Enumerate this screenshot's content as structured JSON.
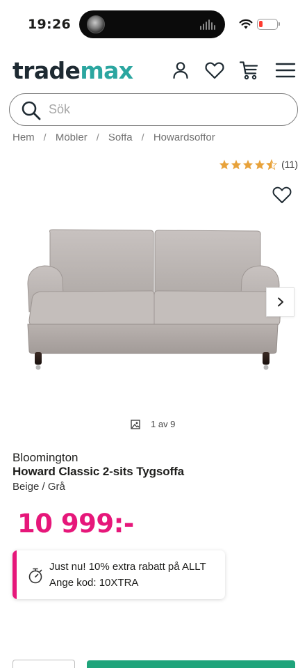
{
  "status_bar": {
    "time": "19:26"
  },
  "header": {
    "logo_part1": "trade",
    "logo_part2": "max",
    "accent_color": "#2ba6a0",
    "icons": [
      "account-icon",
      "heart-icon",
      "cart-icon",
      "menu-icon"
    ]
  },
  "search": {
    "placeholder": "Sök",
    "value": ""
  },
  "breadcrumb": [
    "Hem",
    "Möbler",
    "Soffa",
    "Howardsoffor"
  ],
  "rating": {
    "stars": 4.5,
    "max": 5,
    "count": "(11)",
    "star_color": "#e8a23a"
  },
  "gallery": {
    "counter": "1 av 9"
  },
  "product": {
    "brand": "Bloomington",
    "title": "Howard Classic 2-sits Tygsoffa",
    "variant": "Beige / Grå",
    "price": "10 999:-",
    "price_color": "#e6177a"
  },
  "promo": {
    "line1": "Just nu! 10% extra rabatt på ALLT",
    "line2": "Ange kod: 10XTRA",
    "accent_color": "#e6177a"
  },
  "buttons": {
    "cart_color": "#1fa47b"
  }
}
